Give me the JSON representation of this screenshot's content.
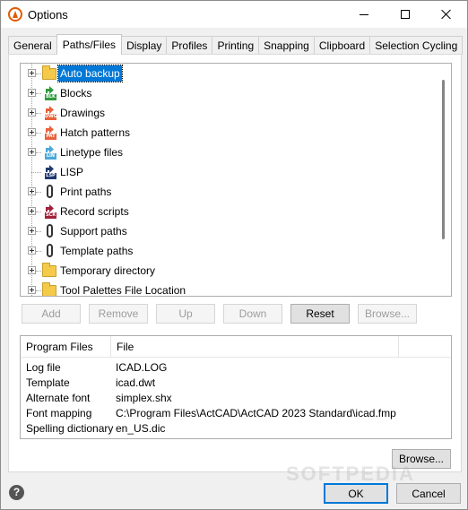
{
  "window": {
    "title": "Options"
  },
  "tabs": [
    {
      "label": "General",
      "active": false
    },
    {
      "label": "Paths/Files",
      "active": true
    },
    {
      "label": "Display",
      "active": false
    },
    {
      "label": "Profiles",
      "active": false
    },
    {
      "label": "Printing",
      "active": false
    },
    {
      "label": "Snapping",
      "active": false
    },
    {
      "label": "Clipboard",
      "active": false
    },
    {
      "label": "Selection Cycling",
      "active": false
    }
  ],
  "tree": {
    "items": [
      {
        "label": "Auto backup",
        "icon": "folder-icon",
        "selected": true
      },
      {
        "label": "Blocks",
        "icon": "blocks-icon",
        "tag": "BLK"
      },
      {
        "label": "Drawings",
        "icon": "drawings-icon",
        "tag": "DWG"
      },
      {
        "label": "Hatch patterns",
        "icon": "hatch-icon",
        "tag": "PAT"
      },
      {
        "label": "Linetype files",
        "icon": "linetype-icon",
        "tag": "LIN"
      },
      {
        "label": "LISP",
        "icon": "lisp-icon",
        "tag": "LSP"
      },
      {
        "label": "Print paths",
        "icon": "paperclip-icon"
      },
      {
        "label": "Record scripts",
        "icon": "script-icon",
        "tag": "SCR"
      },
      {
        "label": "Support paths",
        "icon": "paperclip-icon"
      },
      {
        "label": "Template paths",
        "icon": "paperclip-icon"
      },
      {
        "label": "Temporary directory",
        "icon": "folder-icon"
      },
      {
        "label": "Tool Palettes File Location",
        "icon": "folder-icon"
      }
    ]
  },
  "actions": {
    "add": "Add",
    "remove": "Remove",
    "up": "Up",
    "down": "Down",
    "reset": "Reset",
    "browse_top": "Browse..."
  },
  "details": {
    "headers": [
      "Program Files",
      "File"
    ],
    "rows": [
      {
        "key": "Log file",
        "value": "ICAD.LOG"
      },
      {
        "key": "Template",
        "value": "icad.dwt"
      },
      {
        "key": "Alternate font",
        "value": "simplex.shx"
      },
      {
        "key": "Font mapping",
        "value": "C:\\Program Files\\ActCAD\\ActCAD 2023 Standard\\icad.fmp"
      },
      {
        "key": "Spelling dictionary",
        "value": "en_US.dic"
      }
    ]
  },
  "footer": {
    "browse": "Browse...",
    "ok": "OK",
    "cancel": "Cancel",
    "help": "?"
  },
  "watermark": "SOFTPEDIA",
  "colors": {
    "accent": "#0078d7",
    "folder": "#f5c94a",
    "blocks_tag": "#2e9b3a",
    "dwg_tag": "#e8613a",
    "pat_tag": "#e8613a",
    "lin_tag": "#4aa8d8",
    "lsp_tag": "#1e3a6e",
    "scr_tag": "#a0203a"
  }
}
